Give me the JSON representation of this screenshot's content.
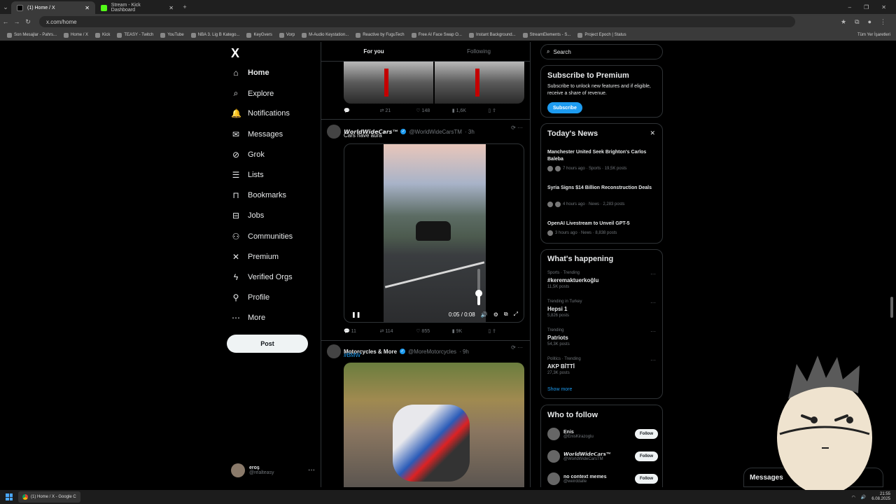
{
  "browser": {
    "tabs": [
      {
        "label": "(1) Home / X",
        "active": true
      },
      {
        "label": "Stream - Kick Dashboard",
        "active": false
      }
    ],
    "url": "x.com/home",
    "bookmarks": [
      "Son Mesajlar - Pahrs...",
      "Home / X",
      "Kick",
      "TEASY - Twitch",
      "YouTube",
      "NBA 3. Lig B Katego...",
      "KeyGvers",
      "Vorp",
      "M-Audio Keystation...",
      "Reactive by FuguTech",
      "Free AI Face Swap O...",
      "Instant Background...",
      "StreamElements - S...",
      "Project Epoch | Status"
    ],
    "bookmarks_right": "Tüm Yer İşaretleri"
  },
  "nav": {
    "logo": "X",
    "items": [
      {
        "label": "Home",
        "icon": "home-icon"
      },
      {
        "label": "Explore",
        "icon": "search-icon"
      },
      {
        "label": "Notifications",
        "icon": "bell-icon"
      },
      {
        "label": "Messages",
        "icon": "envelope-icon"
      },
      {
        "label": "Grok",
        "icon": "grok-icon"
      },
      {
        "label": "Lists",
        "icon": "list-icon"
      },
      {
        "label": "Bookmarks",
        "icon": "bookmark-icon"
      },
      {
        "label": "Jobs",
        "icon": "briefcase-icon"
      },
      {
        "label": "Communities",
        "icon": "people-icon"
      },
      {
        "label": "Premium",
        "icon": "x-icon"
      },
      {
        "label": "Verified Orgs",
        "icon": "lightning-icon"
      },
      {
        "label": "Profile",
        "icon": "person-icon"
      },
      {
        "label": "More",
        "icon": "more-icon"
      }
    ],
    "post_label": "Post",
    "user": {
      "name": "eroş",
      "handle": "@realteasy"
    }
  },
  "feed": {
    "tabs": [
      "For you",
      "Following"
    ],
    "tweet1_actions": {
      "reply": "",
      "retweet": "21",
      "like": "148",
      "views": "1,6K"
    },
    "tweet2": {
      "name": "𝙒𝙤𝙧𝙡𝙙𝙒𝙞𝙙𝙚𝘾𝙖𝙧𝙨™",
      "handle": "@WorldWideCarsTM",
      "time": "· 3h",
      "text": "Cars have aura",
      "video_time": "0:05 / 0:08",
      "actions": {
        "reply": "11",
        "retweet": "114",
        "like": "855",
        "views": "9K"
      }
    },
    "tweet3": {
      "name": "Motorcycles & More",
      "handle": "@MoreMotorcycles",
      "time": "· 9h",
      "text": "#BMW"
    }
  },
  "right": {
    "search_placeholder": "Search",
    "premium": {
      "title": "Subscribe to Premium",
      "body": "Subscribe to unlock new features and if eligible, receive a share of revenue.",
      "button": "Subscribe"
    },
    "news": {
      "title": "Today's News",
      "items": [
        {
          "title": "Manchester United Seek Brighton's Carlos Baleba",
          "meta": "7 hours ago · Sports · 19,5K posts"
        },
        {
          "title": "Syria Signs $14 Billion Reconstruction Deals",
          "meta": "4 hours ago · News · 2,283 posts"
        },
        {
          "title": "OpenAI Livestream to Unveil GPT-5",
          "meta": "3 hours ago · News · 8,838 posts"
        }
      ]
    },
    "happening": {
      "title": "What's happening",
      "items": [
        {
          "category": "Sports · Trending",
          "name": "#keremaktuerkoğlu",
          "posts": "11,5K posts"
        },
        {
          "category": "Trending in Turkey",
          "name": "Hepsi 1",
          "posts": "5,826 posts"
        },
        {
          "category": "Trending",
          "name": "Patriots",
          "posts": "54,3K posts"
        },
        {
          "category": "Politics · Trending",
          "name": "AKP BİTTİ",
          "posts": "27,3K posts"
        }
      ],
      "show_more": "Show more"
    },
    "who_to_follow": {
      "title": "Who to follow",
      "items": [
        {
          "name": "Enis",
          "handle": "@EnisKirazoglu"
        },
        {
          "name": "𝙒𝙤𝙧𝙡𝙙𝙒𝙞𝙙𝙚𝘾𝙖𝙧𝙨™",
          "handle": "@WorldWideCarsTM"
        },
        {
          "name": "no context memes",
          "handle": "@weirddalle"
        }
      ],
      "follow_label": "Follow"
    },
    "messages_label": "Messages"
  },
  "taskbar": {
    "app": "(1) Home / X - Google C",
    "time": "21:55",
    "date": "6.08.2025"
  }
}
